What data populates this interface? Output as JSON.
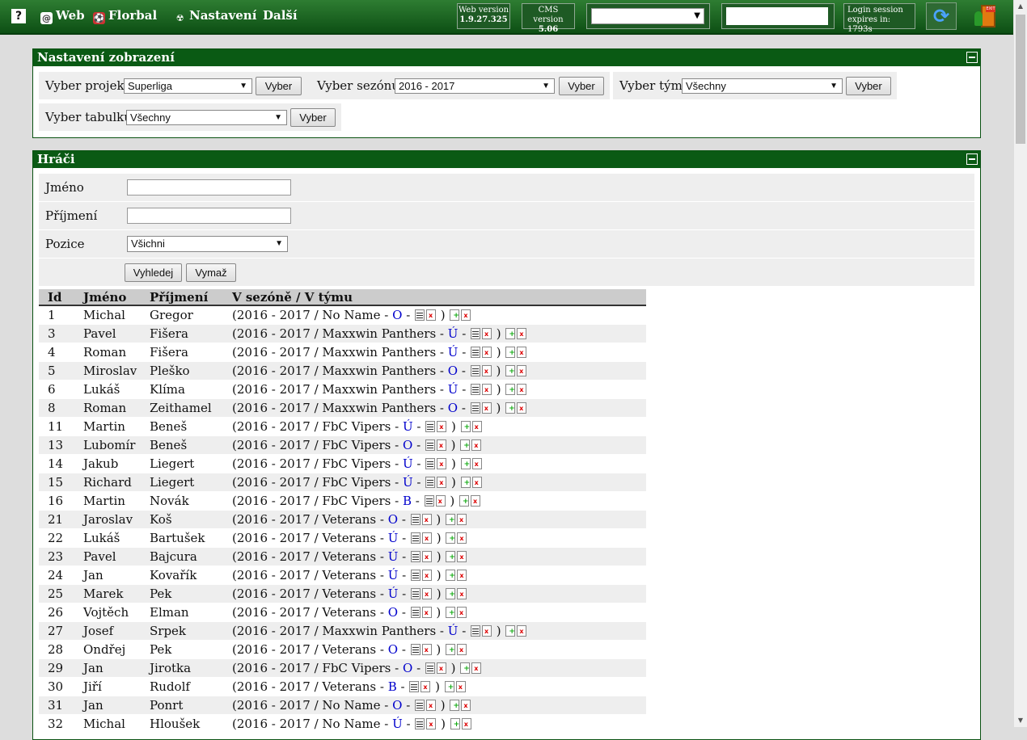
{
  "topbar": {
    "help": "?",
    "links": [
      {
        "icon": "at-icon",
        "glyph": "@",
        "label": "Web"
      },
      {
        "icon": "florbal-ball-icon",
        "glyph": "⚽",
        "label": "Florbal"
      },
      {
        "icon": "radiation-icon",
        "glyph": "☢",
        "label": "Nastavení"
      },
      {
        "icon": "",
        "glyph": "",
        "label": "Další"
      }
    ],
    "web_version_label": "Web version",
    "web_version": "1.9.27.325",
    "cms_version_label": "CMS version",
    "cms_version": "5.06",
    "session_label": "Login session",
    "session_expires": "expires in: 1793s"
  },
  "settings": {
    "title": "Nastavení zobrazení",
    "project_label": "Vyber projekt:",
    "project_value": "Superliga",
    "season_label": "Vyber sezónu:",
    "season_value": "2016 - 2017",
    "team_label": "Vyber tým:",
    "team_value": "Všechny",
    "table_label": "Vyber tabulku:",
    "table_value": "Všechny",
    "button": "Vyber"
  },
  "players": {
    "title": "Hráči",
    "first_name_label": "Jméno",
    "last_name_label": "Příjmení",
    "position_label": "Pozice",
    "position_value": "Všichni",
    "search_button": "Vyhledej",
    "clear_button": "Vymaž",
    "columns": [
      "Id",
      "Jméno",
      "Příjmení",
      "V sezóně / V týmu"
    ],
    "rows": [
      {
        "id": "1",
        "first": "Michal",
        "last": "Gregor",
        "season": "2016 - 2017",
        "team": "No Name",
        "role": "O"
      },
      {
        "id": "3",
        "first": "Pavel",
        "last": "Fišera",
        "season": "2016 - 2017",
        "team": "Maxxwin Panthers",
        "role": "Ú"
      },
      {
        "id": "4",
        "first": "Roman",
        "last": "Fišera",
        "season": "2016 - 2017",
        "team": "Maxxwin Panthers",
        "role": "Ú"
      },
      {
        "id": "5",
        "first": "Miroslav",
        "last": "Pleško",
        "season": "2016 - 2017",
        "team": "Maxxwin Panthers",
        "role": "O"
      },
      {
        "id": "6",
        "first": "Lukáš",
        "last": "Klíma",
        "season": "2016 - 2017",
        "team": "Maxxwin Panthers",
        "role": "Ú"
      },
      {
        "id": "8",
        "first": "Roman",
        "last": "Zeithamel",
        "season": "2016 - 2017",
        "team": "Maxxwin Panthers",
        "role": "O"
      },
      {
        "id": "11",
        "first": "Martin",
        "last": "Beneš",
        "season": "2016 - 2017",
        "team": "FbC Vipers",
        "role": "Ú"
      },
      {
        "id": "13",
        "first": "Lubomír",
        "last": "Beneš",
        "season": "2016 - 2017",
        "team": "FbC Vipers",
        "role": "O"
      },
      {
        "id": "14",
        "first": "Jakub",
        "last": "Liegert",
        "season": "2016 - 2017",
        "team": "FbC Vipers",
        "role": "Ú"
      },
      {
        "id": "15",
        "first": "Richard",
        "last": "Liegert",
        "season": "2016 - 2017",
        "team": "FbC Vipers",
        "role": "Ú"
      },
      {
        "id": "16",
        "first": "Martin",
        "last": "Novák",
        "season": "2016 - 2017",
        "team": "FbC Vipers",
        "role": "B"
      },
      {
        "id": "21",
        "first": "Jaroslav",
        "last": "Koš",
        "season": "2016 - 2017",
        "team": "Veterans",
        "role": "O"
      },
      {
        "id": "22",
        "first": "Lukáš",
        "last": "Bartušek",
        "season": "2016 - 2017",
        "team": "Veterans",
        "role": "Ú"
      },
      {
        "id": "23",
        "first": "Pavel",
        "last": "Bajcura",
        "season": "2016 - 2017",
        "team": "Veterans",
        "role": "Ú"
      },
      {
        "id": "24",
        "first": "Jan",
        "last": "Kovařík",
        "season": "2016 - 2017",
        "team": "Veterans",
        "role": "Ú"
      },
      {
        "id": "25",
        "first": "Marek",
        "last": "Pek",
        "season": "2016 - 2017",
        "team": "Veterans",
        "role": "Ú"
      },
      {
        "id": "26",
        "first": "Vojtěch",
        "last": "Elman",
        "season": "2016 - 2017",
        "team": "Veterans",
        "role": "O"
      },
      {
        "id": "27",
        "first": "Josef",
        "last": "Srpek",
        "season": "2016 - 2017",
        "team": "Maxxwin Panthers",
        "role": "Ú"
      },
      {
        "id": "28",
        "first": "Ondřej",
        "last": "Pek",
        "season": "2016 - 2017",
        "team": "Veterans",
        "role": "O"
      },
      {
        "id": "29",
        "first": "Jan",
        "last": "Jirotka",
        "season": "2016 - 2017",
        "team": "FbC Vipers",
        "role": "O"
      },
      {
        "id": "30",
        "first": "Jiří",
        "last": "Rudolf",
        "season": "2016 - 2017",
        "team": "Veterans",
        "role": "B"
      },
      {
        "id": "31",
        "first": "Jan",
        "last": "Ponrt",
        "season": "2016 - 2017",
        "team": "No Name",
        "role": "O"
      },
      {
        "id": "32",
        "first": "Michal",
        "last": "Hloušek",
        "season": "2016 - 2017",
        "team": "No Name",
        "role": "Ú"
      }
    ]
  }
}
